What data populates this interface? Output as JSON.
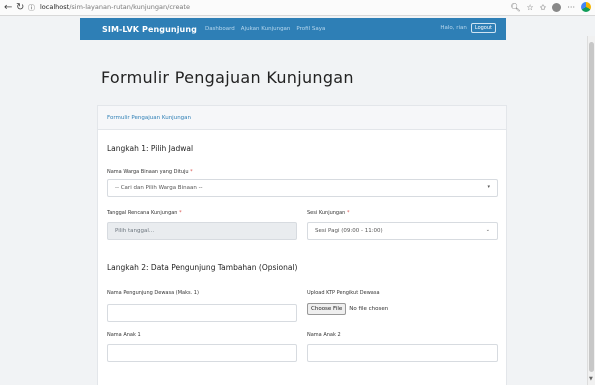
{
  "browser": {
    "url_host": "localhost",
    "url_path": "/sim-layanan-rutan/kunjungan/create"
  },
  "navbar": {
    "brand": "SIM-LVK Pengunjung",
    "links": [
      "Dashboard",
      "Ajukan Kunjungan",
      "Profil Saya"
    ],
    "greeting": "Halo, rian",
    "logout": "Logout"
  },
  "page": {
    "title": "Formulir Pengajuan Kunjungan"
  },
  "form": {
    "header": "Formulir Pengajuan Kunjungan",
    "step1": {
      "heading": "Langkah 1: Pilih Jadwal",
      "warga_label": "Nama Warga Binaan yang Dituju",
      "warga_placeholder": "-- Cari dan Pilih Warga Binaan --",
      "tanggal_label": "Tanggal Rencana Kunjungan",
      "tanggal_placeholder": "Pilih tanggal...",
      "sesi_label": "Sesi Kunjungan",
      "sesi_value": "Sesi Pagi (09:00 - 11:00)"
    },
    "step2": {
      "heading": "Langkah 2: Data Pengunjung Tambahan (Opsional)",
      "dewasa_label": "Nama Pengunjung Dewasa (Maks. 1)",
      "ktp_label": "Upload KTP Pengikut Dewasa",
      "choose_file": "Choose File",
      "no_file": "No file chosen",
      "anak1_label": "Nama Anak 1",
      "anak2_label": "Nama Anak 2"
    },
    "required_mark": "*"
  }
}
